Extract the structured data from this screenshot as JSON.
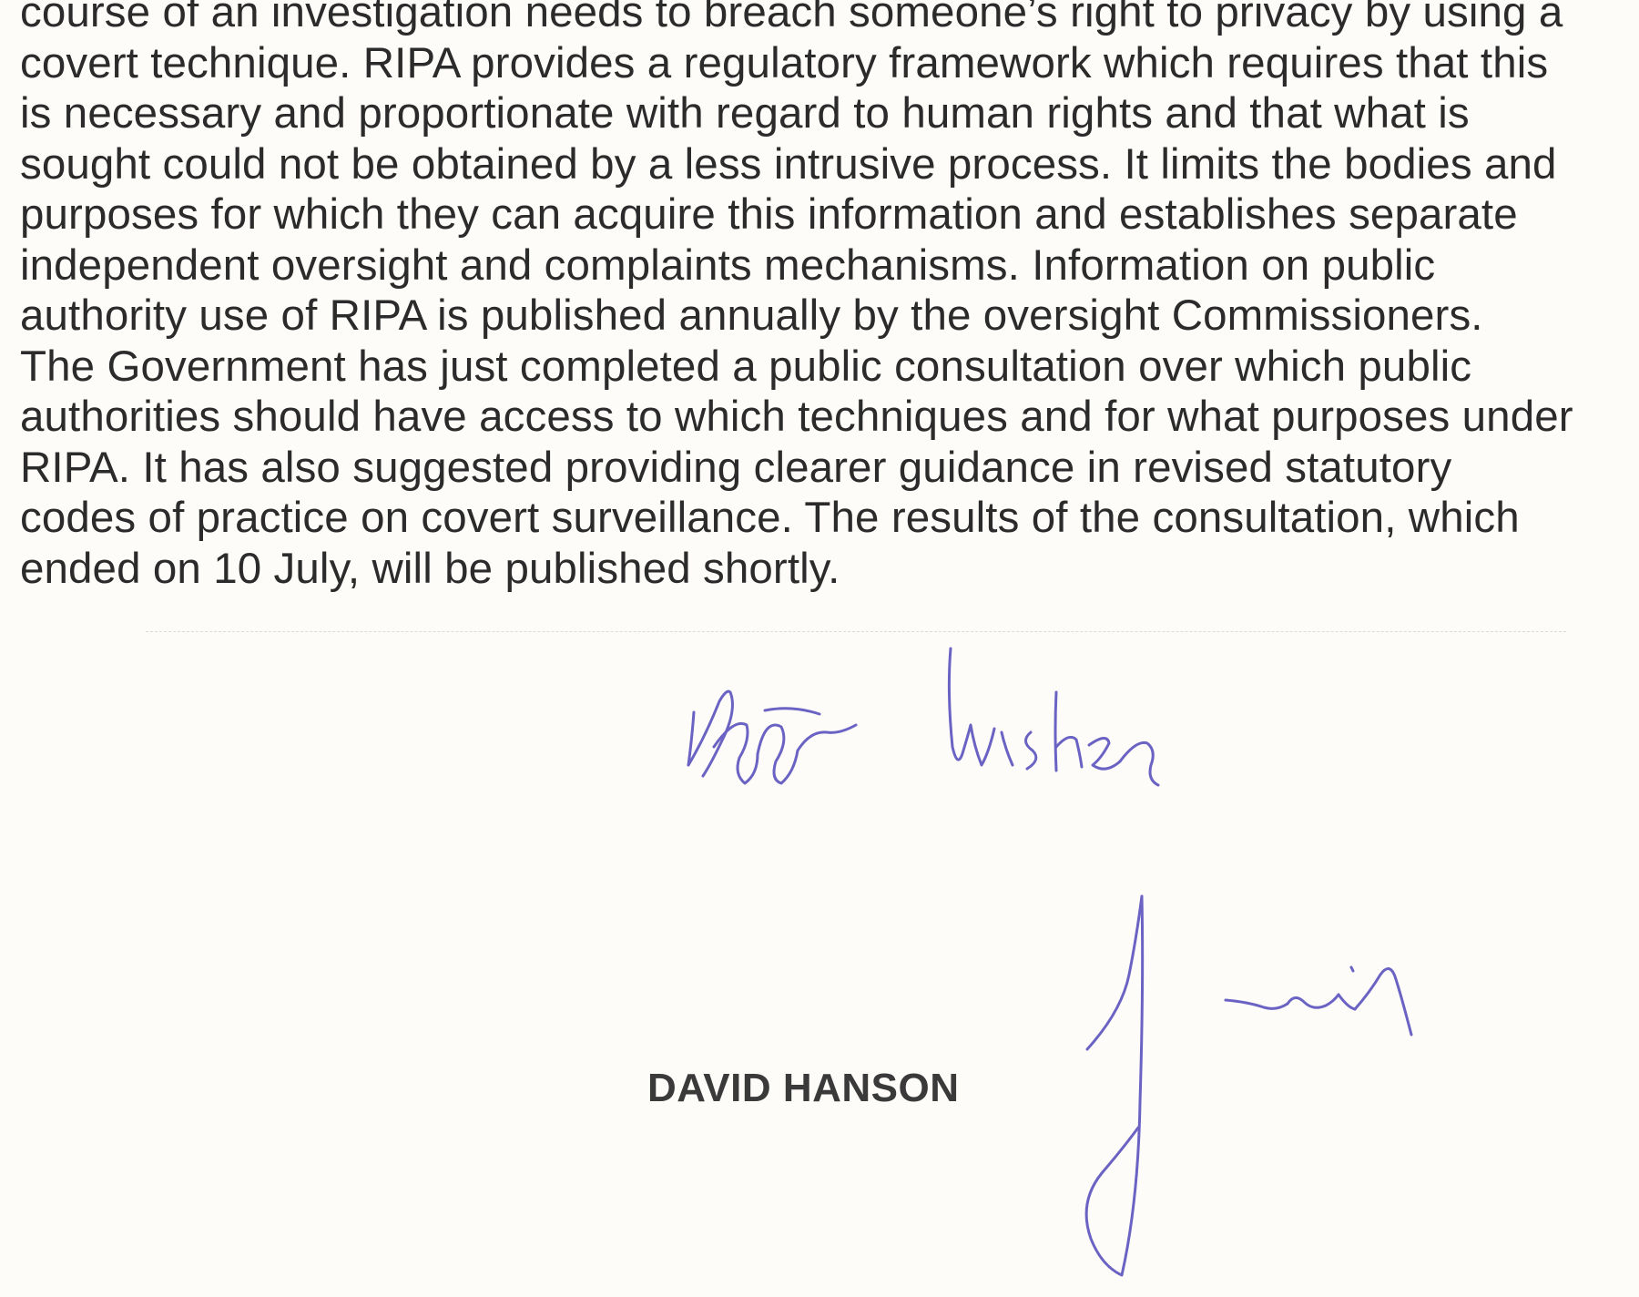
{
  "letter": {
    "body_lines": [
      "course of an investigation needs to breach someone’s right to privacy by using a",
      "covert technique.  RIPA provides a regulatory framework which requires that this",
      "is necessary and proportionate with regard to human rights and that what is",
      "sought could not be obtained by a less intrusive process.  It limits the bodies and",
      "purposes for which they can acquire this information and establishes separate",
      "independent oversight and complaints mechanisms.  Information on public",
      "authority use of RIPA is published annually by the oversight Commissioners.",
      "The Government has just completed a public consultation over which public",
      "authorities should have access to which techniques and for what purposes under",
      "RIPA.  It has also suggested providing clearer guidance in revised statutory",
      "codes of practice on covert surveillance.  The results of the consultation, which",
      "ended on 10 July, will be published shortly."
    ],
    "handwritten_signoff": "Best wishes",
    "signer_name": "DAVID HANSON",
    "ink_color": "#6b63c4"
  }
}
